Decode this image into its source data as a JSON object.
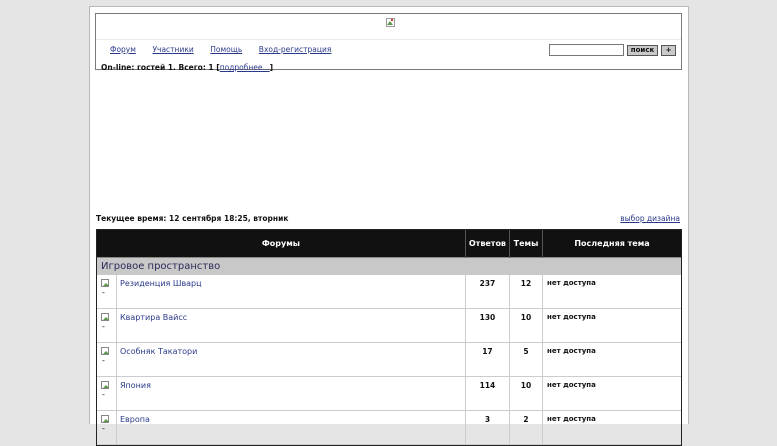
{
  "header": {
    "logo": "broken-image-icon",
    "nav": [
      "Форум",
      "Участники",
      "Помощь",
      "Вход-регистрация"
    ],
    "search_button": "поиск",
    "plus_button": "+"
  },
  "online": {
    "text": "On-line: гостей 1. Всего: 1",
    "link": "подробнее...",
    "open": "[",
    "close": "]"
  },
  "timebar": {
    "label": "Текущее время: 12 сентября 18:25, вторник",
    "design_link": "выбор дизайна"
  },
  "table": {
    "headers": [
      "Форумы",
      "Ответов",
      "Темы",
      "Последняя тема"
    ],
    "category": "Игровое пространство",
    "rows": [
      {
        "name": "Резиденция Шварц",
        "replies": "237",
        "topics": "12",
        "last": "нет доступа"
      },
      {
        "name": "Квартира Вайсс",
        "replies": "130",
        "topics": "10",
        "last": "нет доступа"
      },
      {
        "name": "Особняк Такатори",
        "replies": "17",
        "topics": "5",
        "last": "нет доступа"
      },
      {
        "name": "Япония",
        "replies": "114",
        "topics": "10",
        "last": "нет доступа"
      },
      {
        "name": "Европа",
        "replies": "3",
        "topics": "2",
        "last": "нет доступа"
      }
    ]
  }
}
